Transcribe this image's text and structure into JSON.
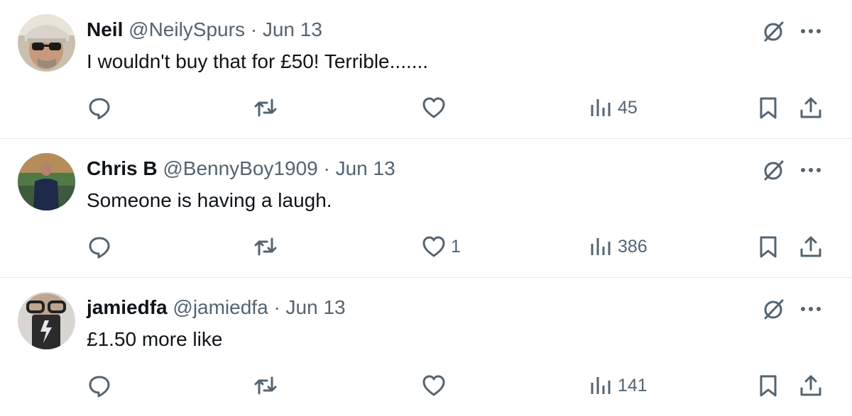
{
  "colors": {
    "text": "#0f1419",
    "secondary": "#536471",
    "divider": "#e5e9ec"
  },
  "tweets": [
    {
      "name": "Neil",
      "handle": "@NeilySpurs",
      "separator": "·",
      "date": "Jun 13",
      "text": "I wouldn't buy that for £50! Terrible.......",
      "likes": "",
      "views": "45"
    },
    {
      "name": "Chris B",
      "handle": "@BennyBoy1909",
      "separator": "·",
      "date": "Jun 13",
      "text": "Someone is having a laugh.",
      "likes": "1",
      "views": "386"
    },
    {
      "name": "jamiedfa",
      "handle": "@jamiedfa",
      "separator": "·",
      "date": "Jun 13",
      "text": "£1.50 more like",
      "likes": "",
      "views": "141"
    }
  ],
  "icons": {
    "reply": "reply-icon",
    "retweet": "retweet-icon",
    "like": "heart-icon",
    "views": "views-icon",
    "bookmark": "bookmark-icon",
    "share": "share-icon",
    "grok": "grok-icon",
    "more": "more-icon"
  }
}
